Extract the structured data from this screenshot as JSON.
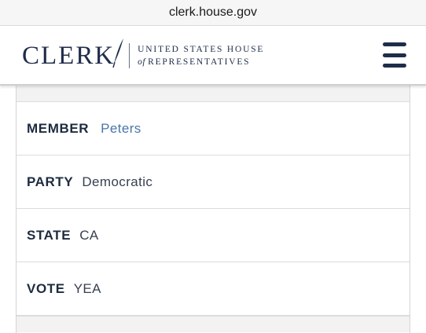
{
  "browser": {
    "url": "clerk.house.gov"
  },
  "header": {
    "logo_word": "CLERK",
    "logo_line1": "UNITED STATES HOUSE",
    "logo_of": "of",
    "logo_line2": "REPRESENTATIVES"
  },
  "vote_detail": {
    "rows": [
      {
        "label": "MEMBER",
        "value": "Peters"
      },
      {
        "label": "PARTY",
        "value": "Democratic"
      },
      {
        "label": "STATE",
        "value": "CA"
      },
      {
        "label": "VOTE",
        "value": "YEA"
      }
    ]
  },
  "colors": {
    "navy": "#1f2d4a",
    "link": "#4a76a8"
  },
  "icons": {
    "menu": "hamburger-menu-icon",
    "logo_mark": "quill-icon"
  }
}
